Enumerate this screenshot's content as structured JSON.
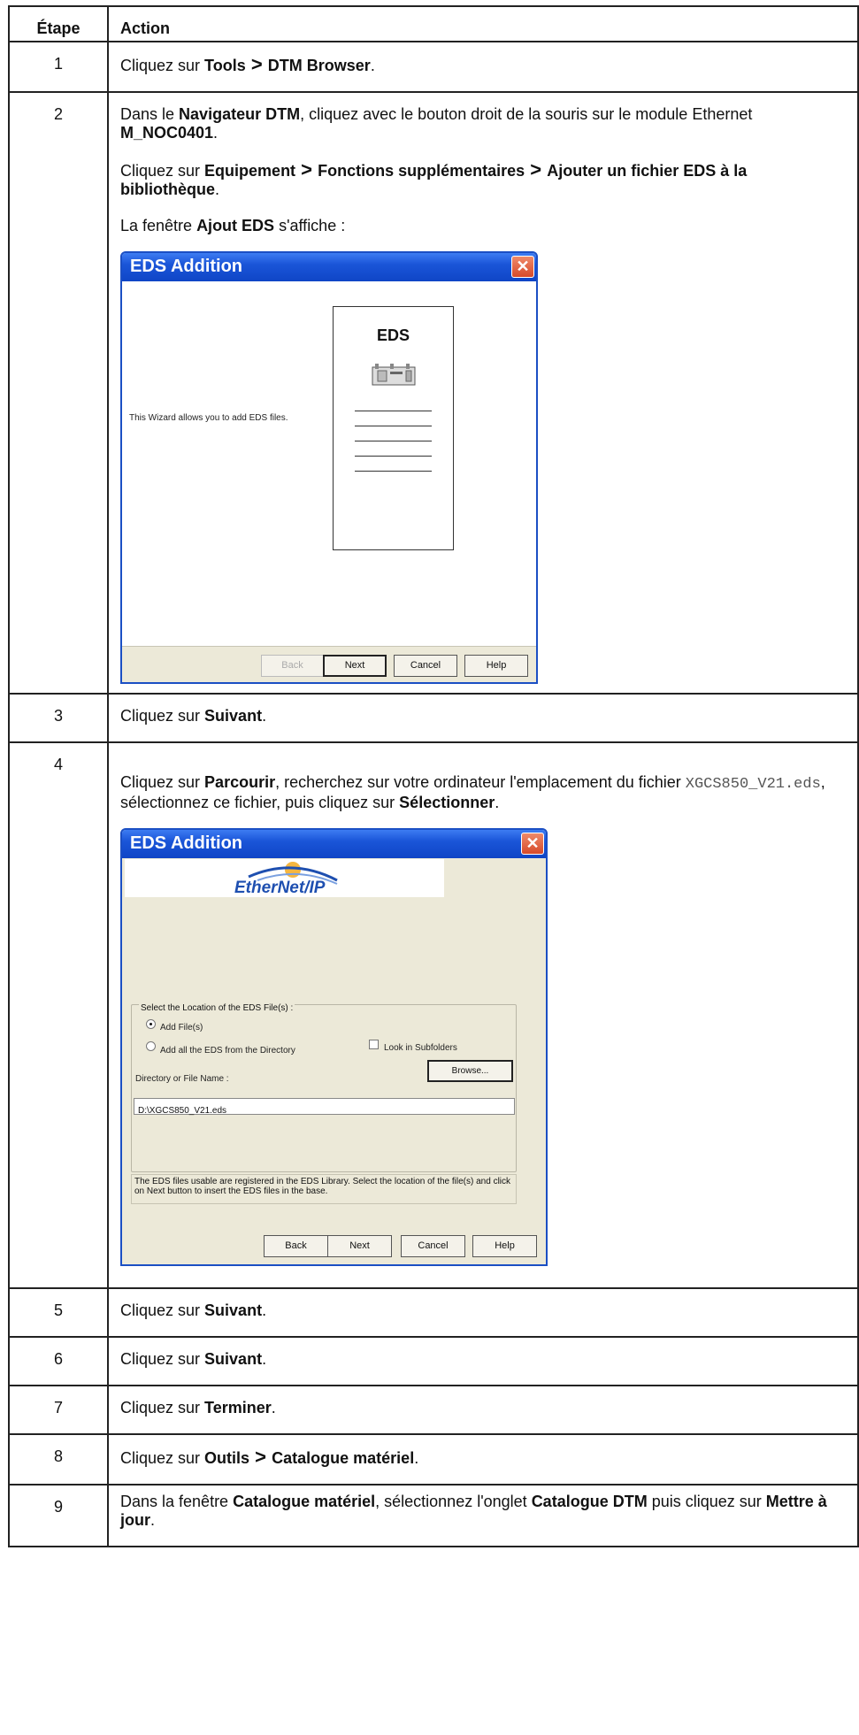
{
  "header": {
    "step": "Étape",
    "action": "Action"
  },
  "rows": [
    {
      "num": "1",
      "p1": {
        "t1": "Cliquez sur ",
        "b1": "Tools",
        "gt": " > ",
        "b2": "DTM Browser",
        "t2": "."
      }
    },
    {
      "num": "2",
      "p1": {
        "t1": "Dans le ",
        "b1": "Navigateur DTM",
        "t2": ", cliquez avec le bouton droit de la souris sur le module Ethernet ",
        "b2": "M_NOC0401",
        "t3": "."
      },
      "p2": {
        "t1": "Cliquez sur ",
        "b1": "Equipement",
        "gt": " > ",
        "b2": "Fonctions supplémentaires",
        "gt2": " > ",
        "b3": "Ajouter un fichier EDS à la bibliothèque",
        "t2": "."
      },
      "p3": {
        "t1": "La fenêtre ",
        "b1": "Ajout EDS",
        "t2": " s'affiche :"
      }
    },
    {
      "num": "3",
      "p1": {
        "t1": "Cliquez sur ",
        "b1": "Suivant",
        "t2": "."
      }
    },
    {
      "num": "4",
      "p1": {
        "t1": "Cliquez sur ",
        "b1": "Parcourir",
        "t2": ", recherchez sur votre ordinateur l'emplacement du fichier ",
        "code": "XGCS850_V21.eds",
        "t3": ", sélectionnez ce fichier, puis cliquez sur ",
        "b2": "Sélectionner",
        "t4": "."
      }
    },
    {
      "num": "5",
      "p1": {
        "t1": "Cliquez sur ",
        "b1": "Suivant",
        "t2": "."
      }
    },
    {
      "num": "6",
      "p1": {
        "t1": "Cliquez sur ",
        "b1": "Suivant",
        "t2": "."
      }
    },
    {
      "num": "7",
      "p1": {
        "t1": "Cliquez sur ",
        "b1": "Terminer",
        "t2": "."
      }
    },
    {
      "num": "8",
      "p1": {
        "t1": "Cliquez sur ",
        "b1": "Outils",
        "gt": " > ",
        "b2": "Catalogue matériel",
        "t2": "."
      }
    },
    {
      "num": "9",
      "p1": {
        "t1": "Dans la fenêtre ",
        "b1": "Catalogue matériel",
        "t2": ", sélectionnez l'onglet ",
        "b2": "Catalogue DTM",
        "t3": " puis cliquez sur ",
        "b3": "Mettre à jour",
        "t4": "."
      }
    }
  ],
  "dialog1": {
    "title": "EDS Addition",
    "wizard_text": "This Wizard allows you to add EDS files.",
    "card_title": "EDS",
    "buttons": {
      "back": "Back",
      "next": "Next",
      "cancel": "Cancel",
      "help": "Help"
    }
  },
  "dialog2": {
    "title": "EDS Addition",
    "logo": "EtherNet/IP",
    "group_legend": "Select the Location of the EDS File(s) :",
    "radio_add_file": "Add File(s)",
    "radio_add_dir": "Add all the EDS from the Directory",
    "check_subfolders": "Look in Subfolders",
    "dir_label": "Directory or File Name :",
    "browse": "Browse...",
    "path_value": "D:\\XGCS850_V21.eds",
    "info": "The EDS files usable are registered in the EDS Library. Select the location of the file(s) and click on Next button to insert the EDS files in the base.",
    "buttons": {
      "back": "Back",
      "next": "Next",
      "cancel": "Cancel",
      "help": "Help"
    }
  }
}
